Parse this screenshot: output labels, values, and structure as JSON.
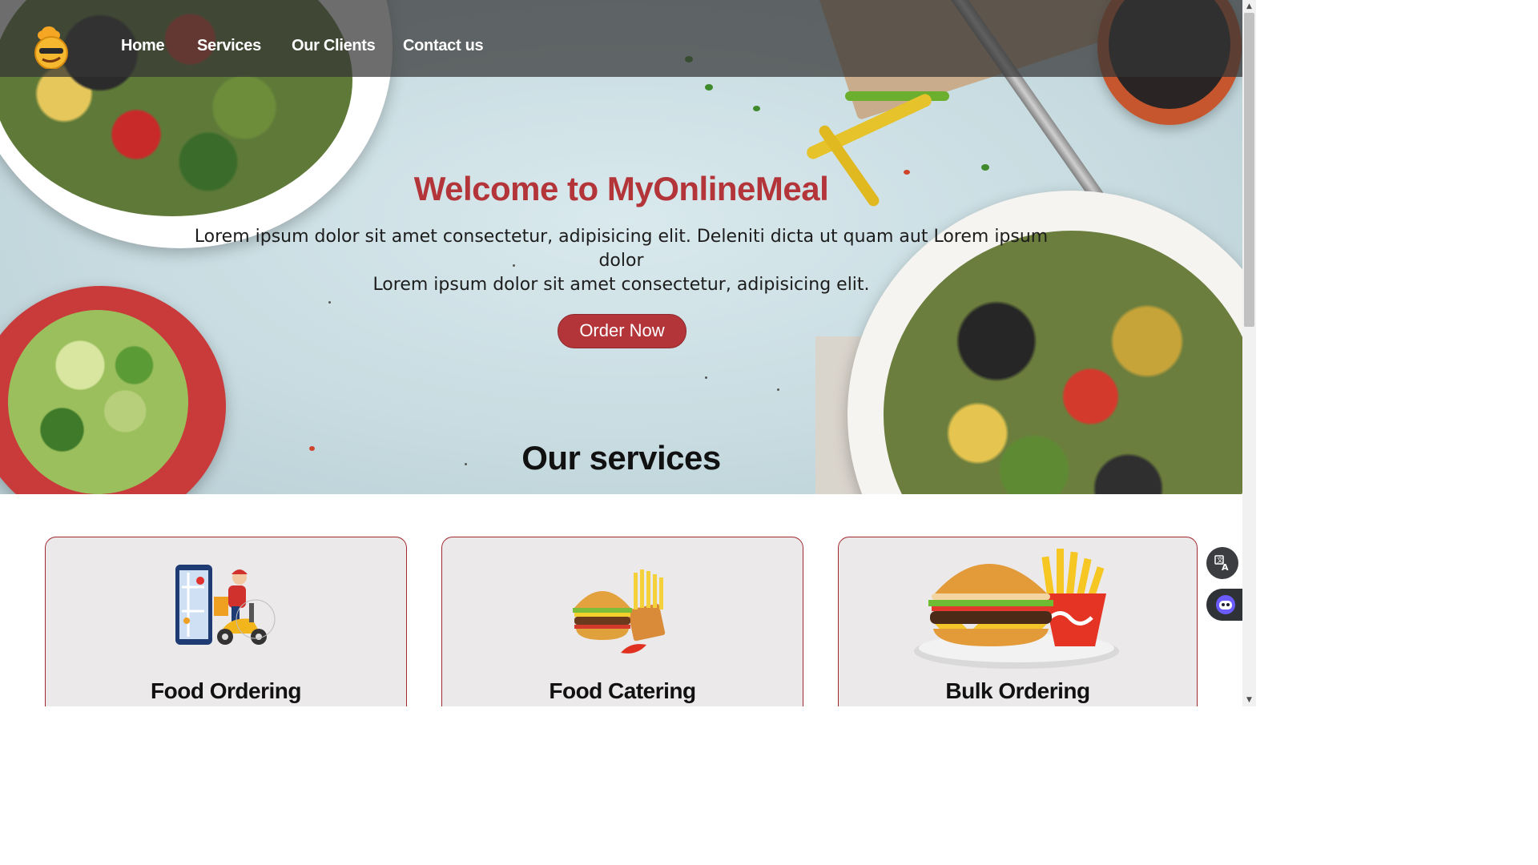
{
  "nav": {
    "links": [
      {
        "label": "Home"
      },
      {
        "label": "Services"
      },
      {
        "label": "Our Clients"
      },
      {
        "label": "Contact us"
      }
    ],
    "logo_icon": "chef-emoji-logo-icon"
  },
  "hero": {
    "title": "Welcome to MyOnlineMeal",
    "subtitle_line1": "Lorem ipsum dolor sit amet consectetur, adipisicing elit. Deleniti dicta ut quam aut Lorem ipsum dolor",
    "subtitle_line2": "Lorem ipsum dolor sit amet consectetur, adipisicing elit.",
    "cta_label": "Order Now"
  },
  "services": {
    "heading": "Our services",
    "cards": [
      {
        "title": "Food Ordering",
        "icon": "delivery-scooter-icon"
      },
      {
        "title": "Food Catering",
        "icon": "burger-fries-icon"
      },
      {
        "title": "Bulk Ordering",
        "icon": "big-burger-fries-icon"
      }
    ]
  },
  "widgets": {
    "translate_icon": "translate-icon",
    "assistant_icon": "assistant-bot-icon"
  },
  "colors": {
    "accent": "#b3353a",
    "nav_bg": "#343434",
    "card_border": "#a0282e",
    "card_bg": "#ebe9ea"
  }
}
